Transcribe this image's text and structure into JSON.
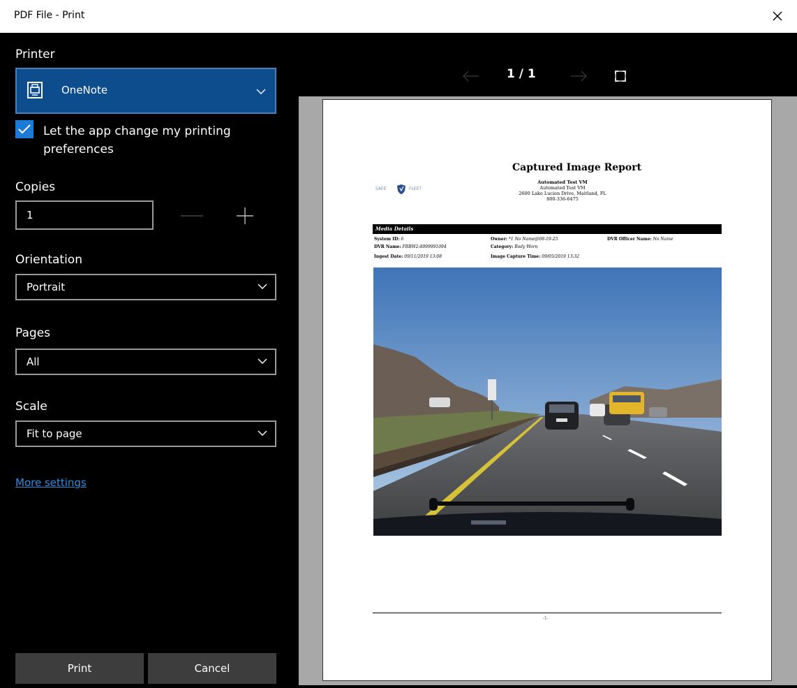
{
  "window": {
    "title": "PDF File - Print"
  },
  "printer": {
    "label": "Printer",
    "selected": "OneNote"
  },
  "preferences": {
    "checked": true,
    "label": "Let the app change my printing preferences"
  },
  "copies": {
    "label": "Copies",
    "value": "1"
  },
  "orientation": {
    "label": "Orientation",
    "value": "Portrait"
  },
  "pages": {
    "label": "Pages",
    "value": "All"
  },
  "scale": {
    "label": "Scale",
    "value": "Fit to page"
  },
  "more_settings": "More settings",
  "buttons": {
    "print": "Print",
    "cancel": "Cancel"
  },
  "pager": {
    "text": "1 / 1"
  },
  "document": {
    "title": "Captured Image Report",
    "logo_left": "SAFE",
    "logo_right": "FLEET",
    "address": {
      "name_bold": "Automated Test VM",
      "name": "Automated Test VM",
      "street": "2600 Lake Lucien Drive, Maitland, FL",
      "phone": "800-336-6475"
    },
    "media_details": {
      "heading": "Media Details",
      "system_id_label": "System ID:",
      "system_id": "6",
      "owner_label": "Owner:",
      "owner": "*1 No Name@08-19-25",
      "officer_label": "DVR Officer Name:",
      "officer": "No Name",
      "dvr_name_label": "DVR Name:",
      "dvr_name": "FBBW2:8999991094",
      "category_label": "Category:",
      "category": "Body Worn",
      "ingest_label": "Ingest Date:",
      "ingest": "09/11/2019 13:08",
      "capture_label": "Image Capture Time:",
      "capture": "09/05/2019 13:32"
    },
    "page_footer": "-1-"
  },
  "colors": {
    "accent": "#1d7ad6",
    "printer_select_bg": "#0e4d8d",
    "link": "#2a8fe3",
    "button_bg": "#3d3d3d",
    "preview_bg": "#a8a8a8"
  }
}
